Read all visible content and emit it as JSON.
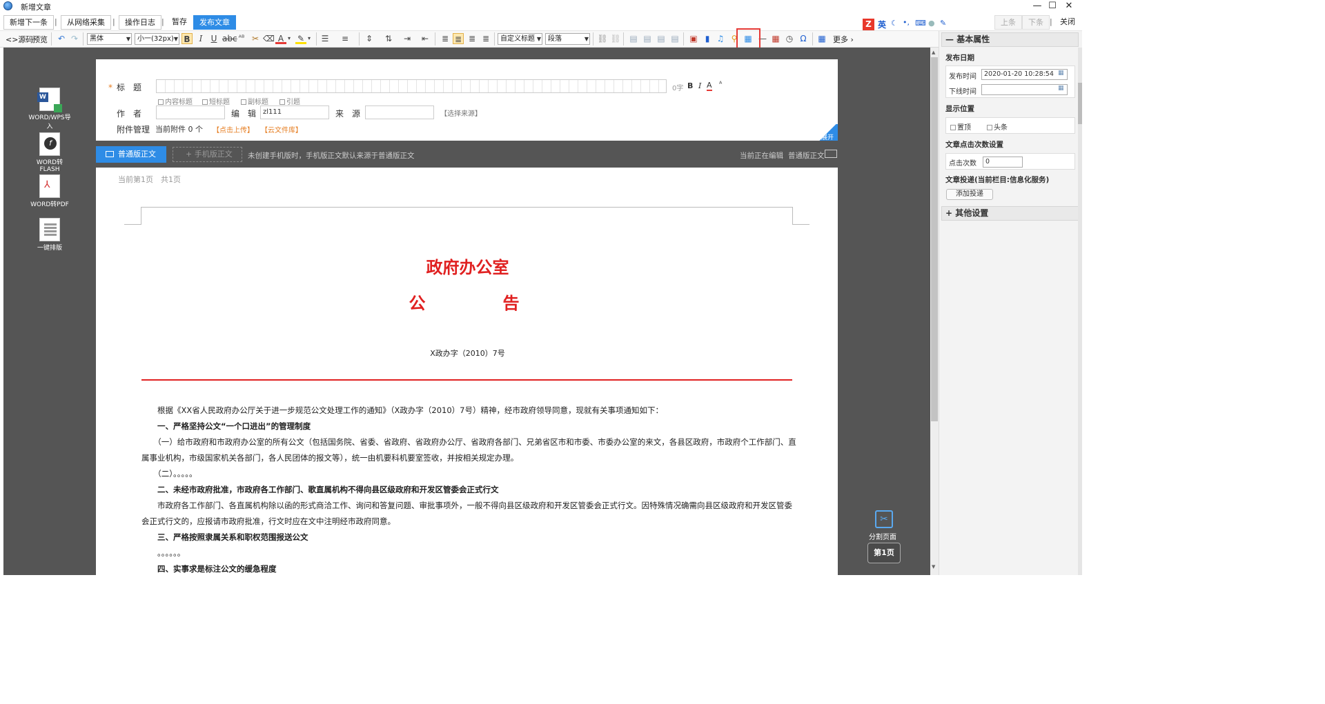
{
  "window": {
    "title": "新增文章",
    "controls": [
      "—",
      "☐",
      "✕"
    ]
  },
  "toolbar_top": {
    "buttons": [
      "新增下一条",
      "从网络采集",
      "操作日志",
      "暂存",
      "发布文章"
    ],
    "separator": "|",
    "right_buttons": [
      "上条",
      "下条",
      "关闭"
    ],
    "ime_label": "英"
  },
  "toolbar_format": {
    "source": "<>源码",
    "preview": "预览",
    "font_family": "黑体",
    "font_size": "小一(32px)",
    "heading_style": "自定义标题",
    "paragraph": "段落",
    "more": "更多"
  },
  "form": {
    "title_label": "标　题",
    "required_mark": "*",
    "title_value": "",
    "char_count": "0字",
    "checkboxes": [
      "内容标题",
      "短标题",
      "副标题",
      "引题"
    ],
    "author_label": "作　者",
    "author_value": "",
    "editor_label": "编　辑",
    "editor_value": "zl111",
    "source_label": "来　源",
    "source_value": "",
    "source_select": "【选择来源】",
    "attach_label": "附件管理",
    "attach_current": "当前附件 0 个",
    "attach_upload": "【点击上传】",
    "attach_cloud": "【云文件库】",
    "expand_label": "展开"
  },
  "tabs": {
    "normal": "普通版正文",
    "mobile": "手机版正文",
    "hint": "未创建手机版时，手机版正文默认来源于普通版正文",
    "editing_label": "当前正在编辑",
    "editing_value": "普通版正文"
  },
  "left_tools": [
    "WORD/WPS导入",
    "WORD转FLASH",
    "WORD转PDF",
    "一键排版"
  ],
  "document": {
    "page_info": "当前第1页　共1页",
    "heading1": "政府办公室",
    "heading2": "公　　　告",
    "doc_number": "X政办字（2010）7号",
    "paragraphs": [
      {
        "text": "　　根据《XX省人民政府办公厅关于进一步规范公文处理工作的通知》（X政办字（2010）7号）精神，经市政府领导同意，现就有关事项通知如下：",
        "bold": false
      },
      {
        "text": "　　一、严格坚持公文“一个口进出”的管理制度",
        "bold": true
      },
      {
        "text": "　　（一）给市政府和市政府办公室的所有公文（包括国务院、省委、省政府、省政府办公厅、省政府各部门、兄弟省区市和市委、市委办公室的来文，各县区政府，市政府个工作部门、直属事业机构，市级国家机关各部门，各人民团体的报文等），统一由机要科机要室签收，并按相关规定办理。",
        "bold": false
      },
      {
        "text": "　　（二）。。。。。",
        "bold": false
      },
      {
        "text": "　　二、未经市政府批准，市政府各工作部门、歌直属机构不得向县区级政府和开发区管委会正式行文",
        "bold": true
      },
      {
        "text": "　　市政府各工作部门、各直属机构除以函的形式商洽工作、询问和答复问题、审批事项外，一般不得向县区级政府和开发区管委会正式行文。因特殊情况确需向县区级政府和开发区管委会正式行文的，应报请市政府批准，行文时应在文中注明经市政府同意。",
        "bold": false
      },
      {
        "text": "　　三、严格按照隶属关系和职权范围报送公文",
        "bold": true
      },
      {
        "text": "　　。。。。。。",
        "bold": false
      },
      {
        "text": "　　四、实事求是标注公文的缓急程度",
        "bold": true
      }
    ],
    "split_page": "分割页面",
    "page_badge": "第1页"
  },
  "properties": {
    "basic_header": "基本属性",
    "publish_date_label": "发布日期",
    "publish_time_label": "发布时间",
    "publish_time_value": "2020-01-20 10:28:54",
    "offline_time_label": "下线时间",
    "offline_time_value": "",
    "display_label": "显示位置",
    "display_options": [
      "置顶",
      "头条"
    ],
    "clicks_label": "文章点击次数设置",
    "clicks_field_label": "点击次数",
    "clicks_value": "0",
    "delivery_label": "文章投递(当前栏目:信息化服务)",
    "add_delivery": "添加投递",
    "other_header": "其他设置"
  },
  "colors": {
    "accent": "#2e8ce6",
    "red": "#e02020",
    "dark_bg": "#555555"
  }
}
